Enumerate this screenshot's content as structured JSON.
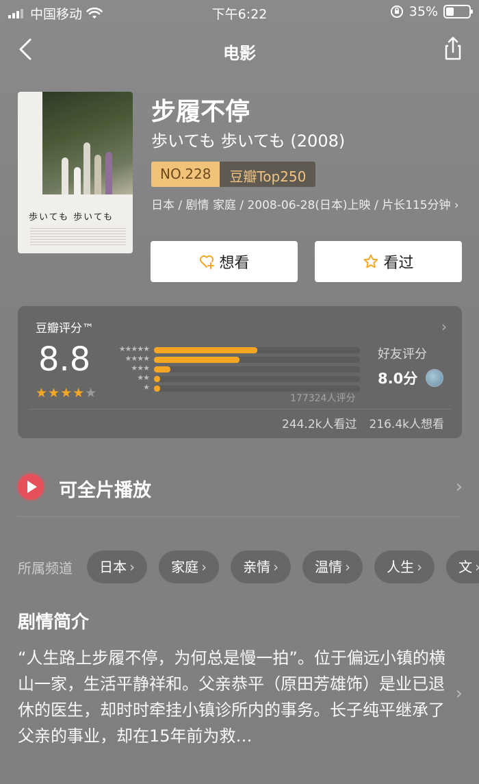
{
  "status": {
    "carrier": "中国移动",
    "time": "下午6:22",
    "battery": "35%",
    "battery_level": 0.35
  },
  "nav": {
    "title": "电影"
  },
  "movie": {
    "title": "步履不停",
    "original": "歩いても 歩いても (2008)",
    "poster_title": "歩いても 歩いても",
    "rank_no": "NO.228",
    "rank_list": "豆瓣Top250",
    "meta": "日本 / 剧情 家庭 / 2008-06-28(日本)上映 / 片长115分钟 ›"
  },
  "actions": {
    "want": "想看",
    "seen": "看过"
  },
  "rating": {
    "brand": "豆瓣评分™",
    "score": "8.8",
    "stars": 4.5,
    "count": "177324人评分",
    "friend_label": "好友评分",
    "friend_score": "8.0分",
    "seen": "244.2k人看过",
    "want": "216.4k人想看",
    "distribution": [
      {
        "stars": "★★★★★",
        "pct": 50
      },
      {
        "stars": "★★★★",
        "pct": 41.5
      },
      {
        "stars": "★★★",
        "pct": 8
      },
      {
        "stars": "★★",
        "pct": 3
      },
      {
        "stars": "★",
        "pct": 3
      }
    ]
  },
  "play": {
    "label": "可全片播放"
  },
  "channels": {
    "label": "所属频道",
    "items": [
      "日本",
      "家庭",
      "亲情",
      "温情",
      "人生",
      "文"
    ]
  },
  "synopsis": {
    "heading": "剧情简介",
    "text": "“人生路上步履不停，为何总是慢一拍”。位于偏远小镇的横山一家，生活平静祥和。父亲恭平（原田芳雄饰）是业已退休的医生，却时时牵挂小镇诊所内的事务。长子纯平继承了父亲的事业，却在15年前为救…"
  }
}
